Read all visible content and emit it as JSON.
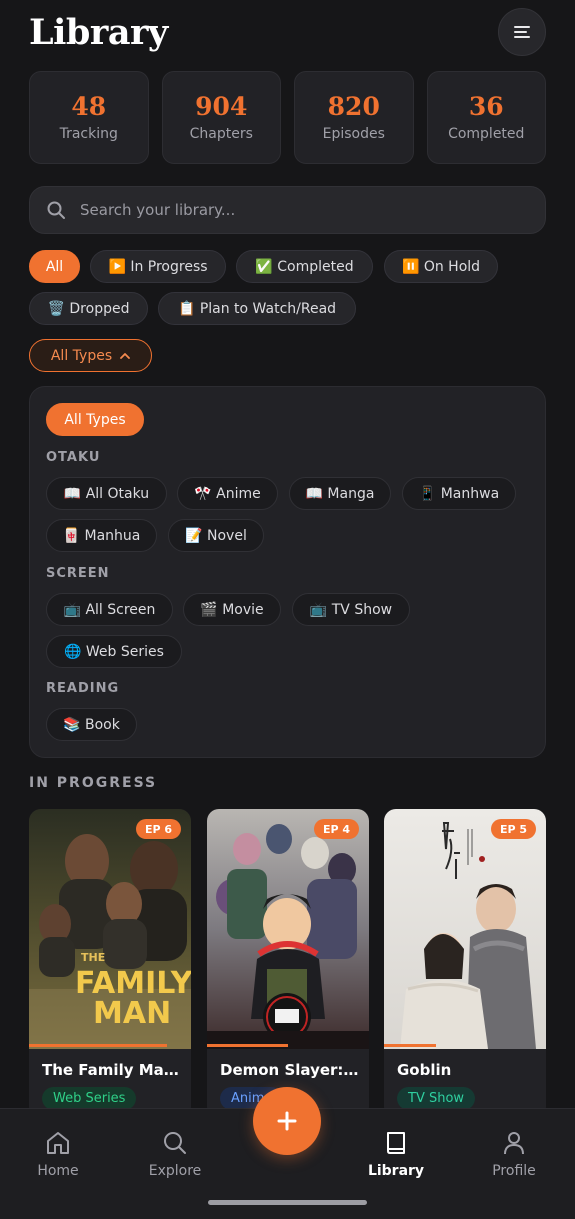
{
  "header": {
    "title": "Library",
    "menu_icon": "menu-icon"
  },
  "stats": [
    {
      "value": "48",
      "label": "Tracking"
    },
    {
      "value": "904",
      "label": "Chapters"
    },
    {
      "value": "820",
      "label": "Episodes"
    },
    {
      "value": "36",
      "label": "Completed"
    }
  ],
  "search": {
    "placeholder": "Search your library...",
    "value": ""
  },
  "status_filters": [
    {
      "label": "All",
      "active": true
    },
    {
      "label": "▶️ In Progress"
    },
    {
      "label": "✅ Completed"
    },
    {
      "label": "⏸️ On Hold"
    },
    {
      "label": "🗑️ Dropped"
    },
    {
      "label": "📋 Plan to Watch/Read"
    }
  ],
  "type_toggle": {
    "label": "All Types",
    "icon": "chevron-up-icon"
  },
  "type_panel": {
    "all_label": "All Types",
    "groups": [
      {
        "label": "OTAKU",
        "items": [
          "📖 All Otaku",
          "🎌 Anime",
          "📖 Manga",
          "📱 Manhwa",
          "🀄 Manhua",
          "📝 Novel"
        ]
      },
      {
        "label": "SCREEN",
        "items": [
          "📺 All Screen",
          "🎬 Movie",
          "📺 TV Show",
          "🌐 Web Series"
        ]
      },
      {
        "label": "READING",
        "items": [
          "📚 Book"
        ]
      }
    ]
  },
  "in_progress": {
    "title": "IN PROGRESS",
    "cards": [
      {
        "title": "The Family Man ...",
        "episode": "EP 6",
        "type": "Web Series",
        "type_color": "#2fd088",
        "type_bg": "#153a2b",
        "progress": 0.85
      },
      {
        "title": "Demon Slayer: K...",
        "episode": "EP 4",
        "type": "Anime",
        "type_color": "#6aa0ff",
        "type_bg": "#1d2b4a",
        "progress": 0.5
      },
      {
        "title": "Goblin",
        "episode": "EP 5",
        "type": "TV Show",
        "type_color": "#2fd0a0",
        "type_bg": "#153a33",
        "progress": 0.32
      }
    ]
  },
  "poster_art": {
    "family_man": {
      "line1": "THE",
      "line2": "FAMILY",
      "line3": "MAN"
    }
  },
  "bottom_nav": {
    "items": [
      {
        "label": "Home",
        "icon": "home-icon"
      },
      {
        "label": "Explore",
        "icon": "search-icon"
      },
      {
        "label": "Library",
        "icon": "book-icon",
        "active": true
      },
      {
        "label": "Profile",
        "icon": "user-icon"
      }
    ],
    "add_icon": "plus-icon"
  },
  "colors": {
    "accent": "#f07230",
    "background": "#161618",
    "surface": "#222226"
  }
}
